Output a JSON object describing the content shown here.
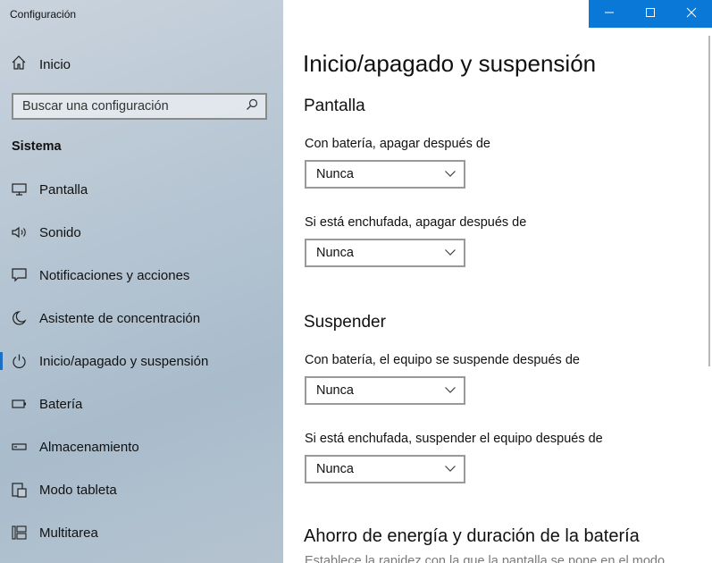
{
  "app": {
    "title": "Configuración"
  },
  "sidebar": {
    "home_label": "Inicio",
    "search_placeholder": "Buscar una configuración",
    "section_title": "Sistema",
    "items": [
      {
        "label": "Pantalla",
        "icon": "monitor-icon"
      },
      {
        "label": "Sonido",
        "icon": "speaker-icon"
      },
      {
        "label": "Notificaciones y acciones",
        "icon": "notification-icon"
      },
      {
        "label": "Asistente de concentración",
        "icon": "moon-icon"
      },
      {
        "label": "Inicio/apagado y suspensión",
        "icon": "power-icon",
        "active": true
      },
      {
        "label": "Batería",
        "icon": "battery-icon"
      },
      {
        "label": "Almacenamiento",
        "icon": "storage-icon"
      },
      {
        "label": "Modo tableta",
        "icon": "tablet-icon"
      },
      {
        "label": "Multitarea",
        "icon": "multitask-icon"
      }
    ]
  },
  "main": {
    "title": "Inicio/apagado y suspensión",
    "screen": {
      "heading": "Pantalla",
      "battery_label": "Con batería, apagar después de",
      "battery_value": "Nunca",
      "plugged_label": "Si está enchufada, apagar después de",
      "plugged_value": "Nunca"
    },
    "sleep": {
      "heading": "Suspender",
      "battery_label": "Con batería, el equipo se suspende después de",
      "battery_value": "Nunca",
      "plugged_label": "Si está enchufada, suspender el equipo después de",
      "plugged_value": "Nunca"
    },
    "energy": {
      "heading": "Ahorro de energía y duración de la batería",
      "description_partial": "Establece la rapidez con la que la pantalla se pone en el modo"
    }
  },
  "window_controls": {
    "accent": "#0a78d7"
  },
  "colors": {
    "accent": "#1c6fc3",
    "sidebar_bg": "#b9c7d4"
  }
}
